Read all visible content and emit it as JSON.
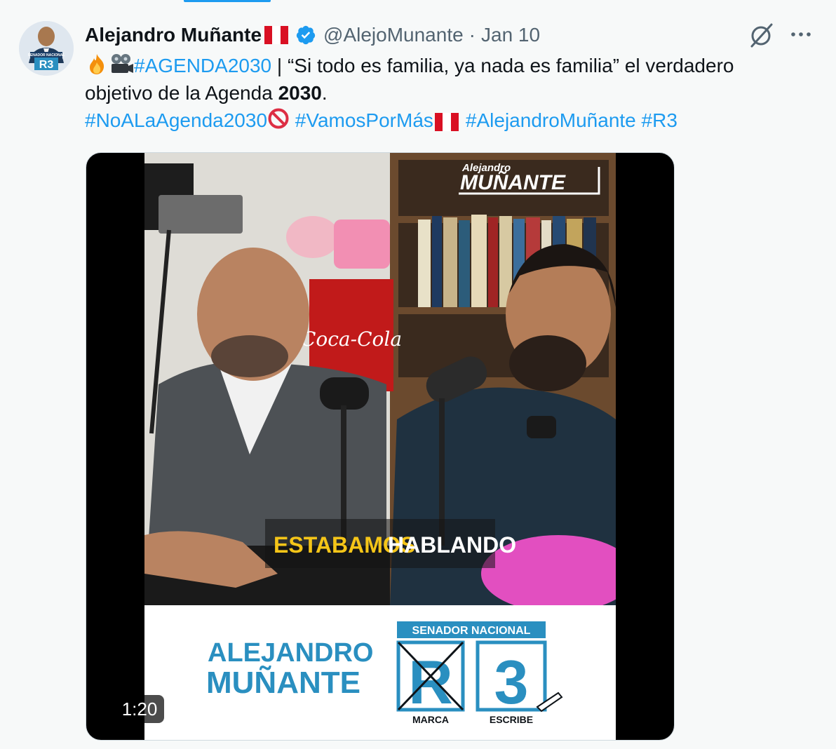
{
  "author": {
    "display_name": "Alejandro Muñante",
    "handle": "@AlejoMunante",
    "separator": "·",
    "date": "Jan 10",
    "avatar_badge": "R3",
    "avatar_caption": "SENADOR NACIONAL"
  },
  "tweet": {
    "line1_hashtag": "#AGENDA2030",
    "line1_rest": " | “Si todo es familia, ya nada es familia” el verdadero",
    "line2_pre": "objetivo de la Agenda ",
    "line2_bold": "2030",
    "line2_post": ".",
    "hashtag_1": "#NoALaAgenda2030",
    "hashtag_2": "#VamosPorMás",
    "hashtag_3": "#AlejandroMuñante",
    "hashtag_4": "#R3"
  },
  "video": {
    "duration": "1:20",
    "overlay_brand_small": "Alejandro",
    "overlay_brand_big": "MUÑANTE",
    "subtitle_word1": "ESTABAMOS",
    "subtitle_word2": "HABLANDO",
    "banner_name_line1": "ALEJANDRO",
    "banner_name_line2": "MUÑANTE",
    "banner_title": "SENADOR NACIONAL",
    "banner_letter": "R",
    "banner_number": "3",
    "banner_label_left": "MARCA",
    "banner_label_right": "ESCRIBE",
    "mug_text": "Coca-Cola"
  },
  "icons": {
    "fire": "fire-icon",
    "camera": "film-projector-icon",
    "prohibited": "prohibited-icon",
    "verified": "verified-badge-icon",
    "grok": "grok-icon",
    "more": "more-icon"
  },
  "colors": {
    "link": "#1d9bf0",
    "text": "#0f1419",
    "secondary": "#536471",
    "brand_blue": "#2a8fc0",
    "peru_red": "#d91023"
  }
}
